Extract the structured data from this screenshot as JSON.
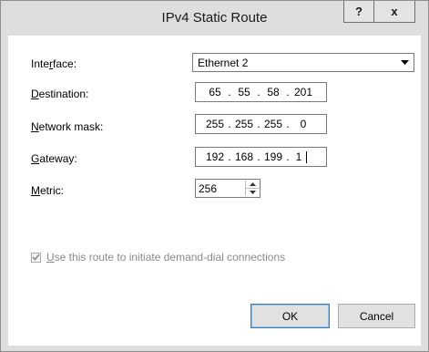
{
  "window": {
    "title": "IPv4 Static Route",
    "help_label": "?",
    "close_label": "x"
  },
  "form": {
    "interface": {
      "label_pre": "Inte",
      "label_acc": "r",
      "label_post": "face:",
      "value": "Ethernet 2"
    },
    "destination": {
      "label_acc": "D",
      "label_post": "estination:",
      "octets": [
        "65",
        "55",
        "58",
        "201"
      ]
    },
    "mask": {
      "label_acc": "N",
      "label_post": "etwork mask:",
      "octets": [
        "255",
        "255",
        "255",
        "0"
      ]
    },
    "gateway": {
      "label_acc": "G",
      "label_post": "ateway:",
      "octets": [
        "192",
        "168",
        "199",
        "1"
      ]
    },
    "metric": {
      "label_acc": "M",
      "label_post": "etric:",
      "value": "256"
    }
  },
  "demand_dial": {
    "label_acc": "U",
    "label_post": "se this route to initiate demand-dial connections",
    "checked": true,
    "enabled": false
  },
  "buttons": {
    "ok": "OK",
    "cancel": "Cancel"
  },
  "icons": {
    "dropdown": "chevron-down-icon",
    "spin_up": "spin-up-icon",
    "spin_down": "spin-down-icon",
    "check": "checkmark-icon"
  }
}
